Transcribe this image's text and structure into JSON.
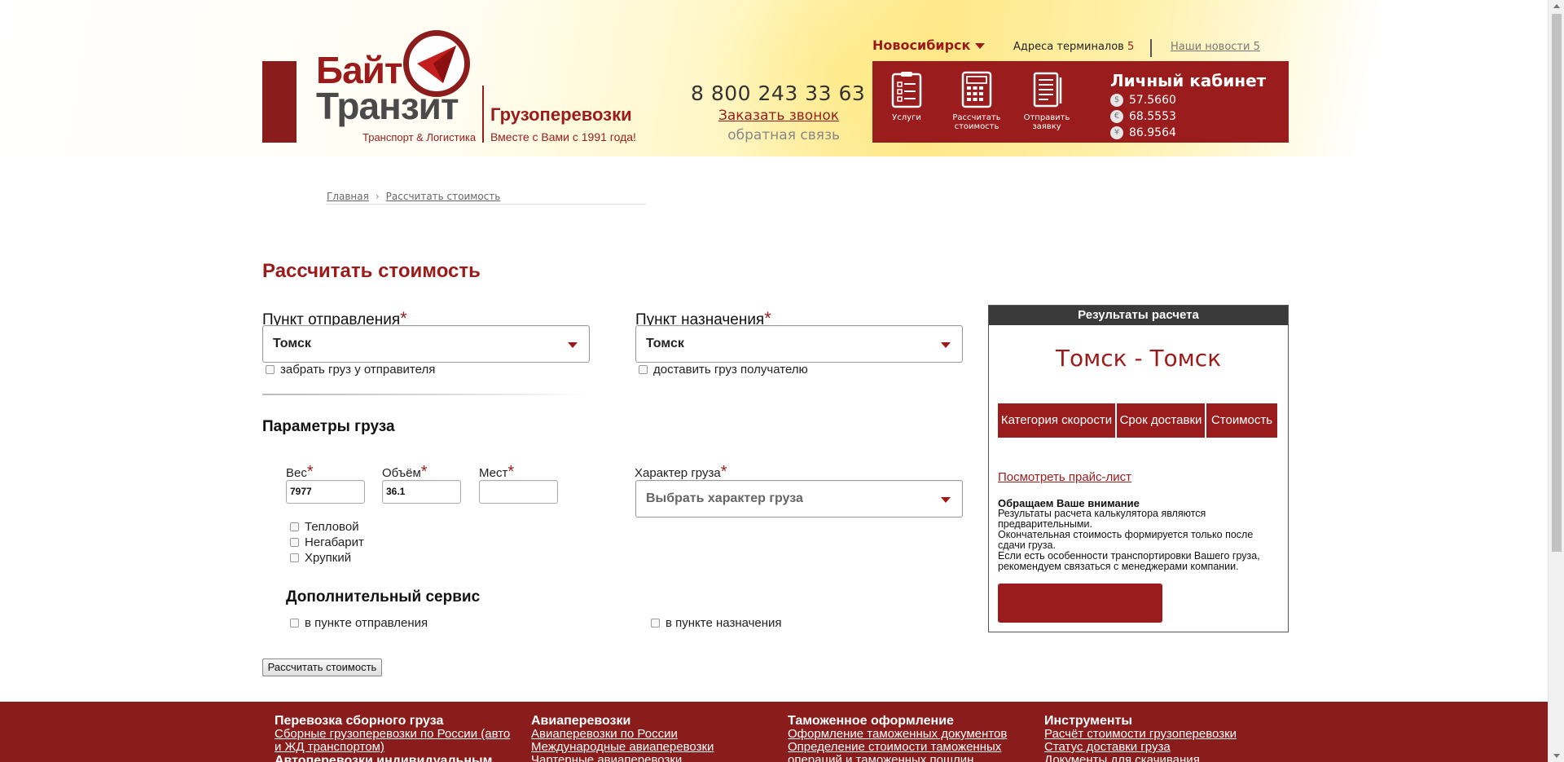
{
  "header": {
    "logo": {
      "word1": "Байт",
      "word2": "Транзит",
      "tagline": "Транспорт & Логистика",
      "service": "Грузоперевозки",
      "since": "Вместе с Вами с 1991 года!"
    },
    "phone": "8 800 243 33 63",
    "callback_label": "Заказать звонок",
    "feedback_label": "обратная связь",
    "city": "Новосибирск",
    "terminals_label": "Адреса терминалов",
    "terminals_count": "5",
    "news_label": "Наши новости 5",
    "tools": [
      {
        "label": "Услуги",
        "icon": "clipboard-list-icon"
      },
      {
        "label": "Рассчитать стоимость",
        "icon": "calculator-icon"
      },
      {
        "label": "Отправить заявку",
        "icon": "document-form-icon"
      }
    ],
    "cabinet_label": "Личный кабинет",
    "rates": [
      {
        "symbol": "$",
        "value": "57.5660"
      },
      {
        "symbol": "€",
        "value": "68.5553"
      },
      {
        "symbol": "¥",
        "value": "86.9564"
      }
    ]
  },
  "breadcrumb": {
    "home": "Главная",
    "current": "Рассчитать стоимость"
  },
  "form": {
    "title": "Рассчитать стоимость",
    "from_label": "Пункт отправления",
    "from_value": "Томск",
    "pickup_label": "забрать груз у отправителя",
    "to_label": "Пункт назначения",
    "to_value": "Томск",
    "deliver_label": "доставить груз получателю",
    "params_title": "Параметры груза",
    "weight_label": "Вес",
    "weight_value": "7977",
    "volume_label": "Объём",
    "volume_value": "36.1",
    "places_label": "Мест",
    "places_value": "",
    "cargo_type_label": "Характер груза",
    "cargo_type_placeholder": "Выбрать характер груза",
    "options": [
      "Тепловой",
      "Негабарит",
      "Хрупкий"
    ],
    "extra_title": "Дополнительный сервис",
    "extra_from": "в пункте отправления",
    "extra_to": "в пункте назначения",
    "submit_label": "Рассчитать стоимость",
    "required_mark": "*"
  },
  "results": {
    "title": "Результаты расчета",
    "route": "Томск - Томск",
    "columns": [
      "Категория скорости",
      "Срок доставки",
      "Стоимость"
    ],
    "pricelist_label": "Посмотреть прайс-лист",
    "notice_title": "Обращаем Ваше внимание",
    "notice_lines": [
      "Результаты расчета калькулятора являются предварительными.",
      "Окончательная стоимость формируется только после сдачи груза.",
      "Если есть особенности транспортировки Вашего груза, рекомендуем связаться с менеджерами компании."
    ]
  },
  "footer": {
    "col1": {
      "head": "Перевозка сборного груза",
      "link": "Сборные грузоперевозки по России (авто и ЖД транспортом)",
      "extra": "Автоперевозки индивидуальным"
    },
    "col2": {
      "head": "Авиаперевозки",
      "links": [
        "Авиаперевозки по России",
        "Международные авиаперевозки",
        "Чартерные авиаперевозки"
      ]
    },
    "col3": {
      "head": "Таможенное оформление",
      "links": [
        "Оформление таможенных документов",
        "Определение стоимости таможенных операций и таможенных пошлин"
      ]
    },
    "col4": {
      "head": "Инструменты",
      "links": [
        "Расчёт стоимости грузоперевозки",
        "Статус доставки груза",
        "Документы для скачивания"
      ]
    }
  },
  "colors": {
    "brand_red": "#9b1c1c",
    "dark_gray": "#3a3a3a"
  }
}
